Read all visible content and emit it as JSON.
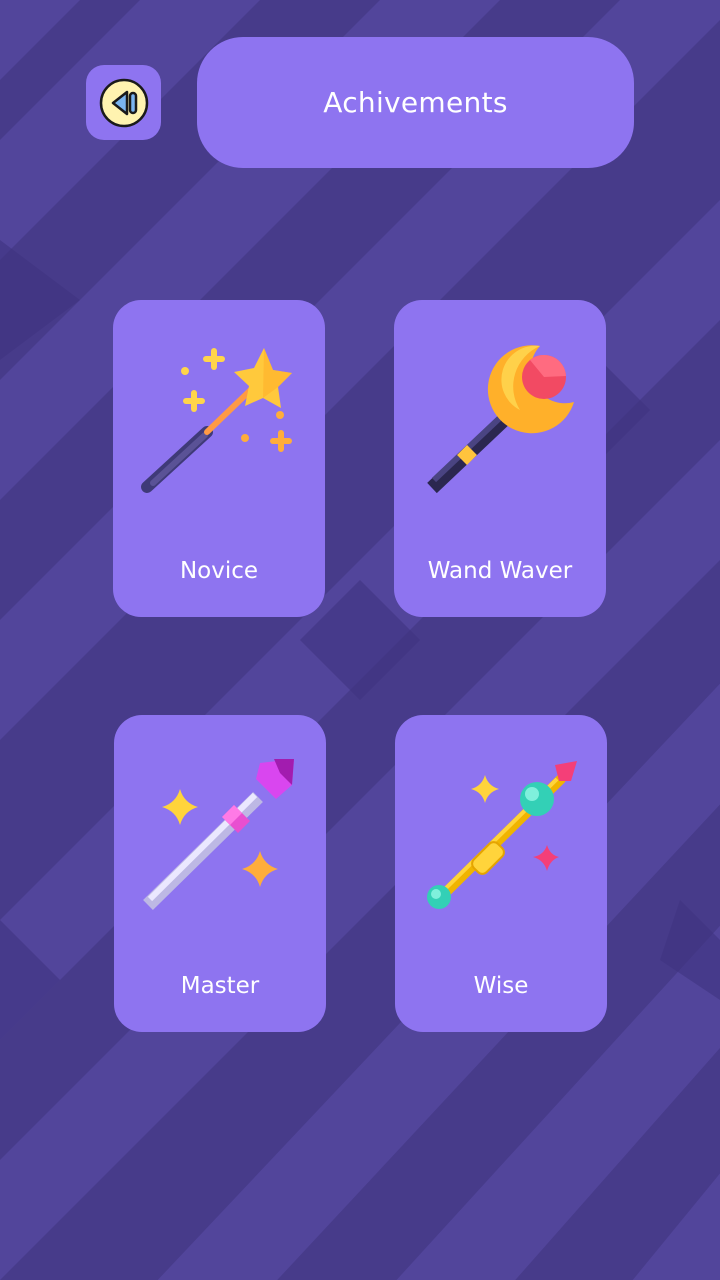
{
  "header": {
    "title": "Achivements",
    "back_icon": "back-arrow-icon"
  },
  "achievements": [
    {
      "label": "Novice",
      "icon": "star-wand-icon"
    },
    {
      "label": "Wand Waver",
      "icon": "moon-orb-wand-icon"
    },
    {
      "label": "Master",
      "icon": "crystal-wand-icon"
    },
    {
      "label": "Wise",
      "icon": "jeweled-staff-icon"
    }
  ],
  "colors": {
    "background": "#473b8a",
    "background_stripe": "#52459b",
    "panel": "#8e74f0",
    "text": "#ffffff",
    "back_icon_fill": "#fff3b0"
  }
}
